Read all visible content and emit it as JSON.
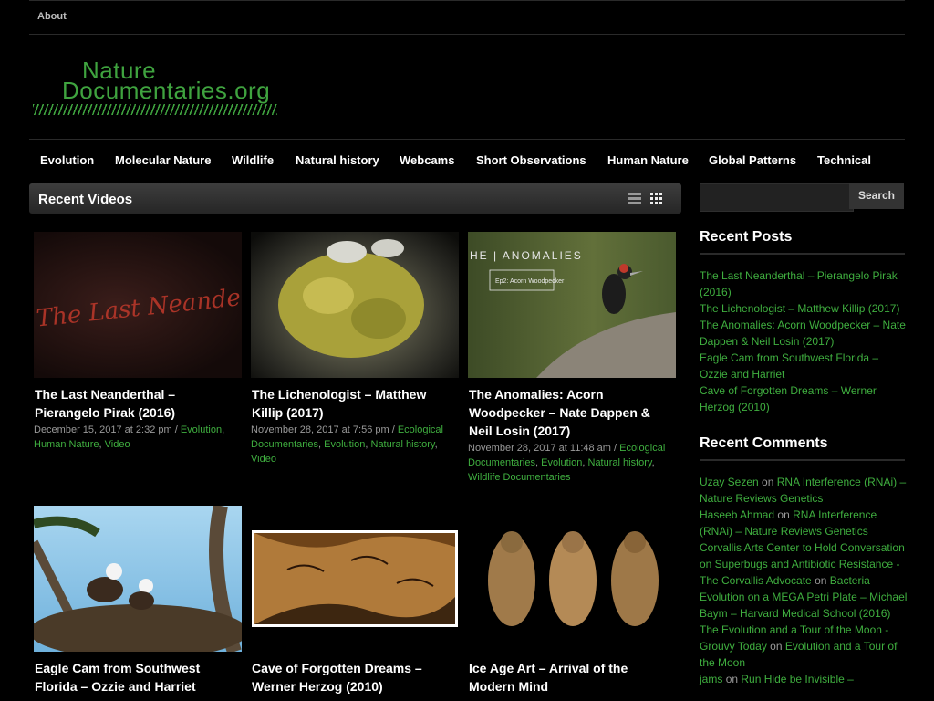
{
  "top_menu": {
    "about": "About"
  },
  "logo": {
    "line1": "Nature",
    "line2": "Documentaries.org"
  },
  "nav": [
    "Evolution",
    "Molecular Nature",
    "Wildlife",
    "Natural history",
    "Webcams",
    "Short Observations",
    "Human Nature",
    "Global Patterns",
    "Technical"
  ],
  "recent_videos": {
    "title": "Recent Videos",
    "view_icons": [
      "list-view-icon",
      "grid-view-icon"
    ],
    "items": [
      {
        "title": "The Last Neanderthal – Pierangelo Pirak (2016)",
        "date": "December 15, 2017 at 2:32 pm",
        "categories": [
          "Evolution",
          "Human Nature",
          "Video"
        ],
        "thumb_text": "The Last Neanderthal"
      },
      {
        "title": "The Lichenologist – Matthew Killip (2017)",
        "date": "November 28, 2017 at 7:56 pm",
        "categories": [
          "Ecological Documentaries",
          "Evolution",
          "Natural history",
          "Video"
        ]
      },
      {
        "title": "The Anomalies: Acorn Woodpecker – Nate Dappen & Neil Losin (2017)",
        "date": "November 28, 2017 at 11:48 am",
        "categories": [
          "Ecological Documentaries",
          "Evolution",
          "Natural history",
          "Wildlife Documentaries"
        ],
        "thumb_text": "HE | ANOMALIES",
        "thumb_sub": "Ep2: Acorn Woodpecker"
      },
      {
        "title": "Eagle Cam from Southwest Florida – Ozzie and Harriet"
      },
      {
        "title": "Cave of Forgotten Dreams – Werner Herzog (2010)"
      },
      {
        "title": "Ice Age Art – Arrival of the Modern Mind"
      }
    ]
  },
  "search": {
    "placeholder": "",
    "button": "Search"
  },
  "sidebar": {
    "recent_posts_title": "Recent Posts",
    "recent_posts": [
      "The Last Neanderthal – Pierangelo Pirak (2016)",
      "The Lichenologist – Matthew Killip (2017)",
      "The Anomalies: Acorn Woodpecker – Nate Dappen & Neil Losin (2017)",
      "Eagle Cam from Southwest Florida – Ozzie and Harriet",
      "Cave of Forgotten Dreams – Werner Herzog (2010)"
    ],
    "recent_comments_title": "Recent Comments",
    "recent_comments": [
      {
        "author": "Uzay Sezen",
        "on": "on",
        "post": "RNA Interference (RNAi) – Nature Reviews Genetics"
      },
      {
        "author": "Haseeb Ahmad",
        "on": "on",
        "post": "RNA Interference (RNAi) – Nature Reviews Genetics"
      },
      {
        "author": "Corvallis Arts Center to Hold Conversation on Superbugs and Antibiotic Resistance - The Corvallis Advocate",
        "on": "on",
        "post": "Bacteria Evolution on a MEGA Petri Plate – Michael Baym – Harvard Medical School (2016)"
      },
      {
        "author": "The Evolution and a Tour of the Moon - Grouvy Today",
        "on": "on",
        "post": "Evolution and a Tour of the Moon"
      },
      {
        "author": "jams",
        "on": "on",
        "post": "Run Hide be Invisible –"
      }
    ]
  },
  "colors": {
    "background": "#000000",
    "accent_green": "#3fae3f",
    "logo_green": "#3fa33f"
  }
}
